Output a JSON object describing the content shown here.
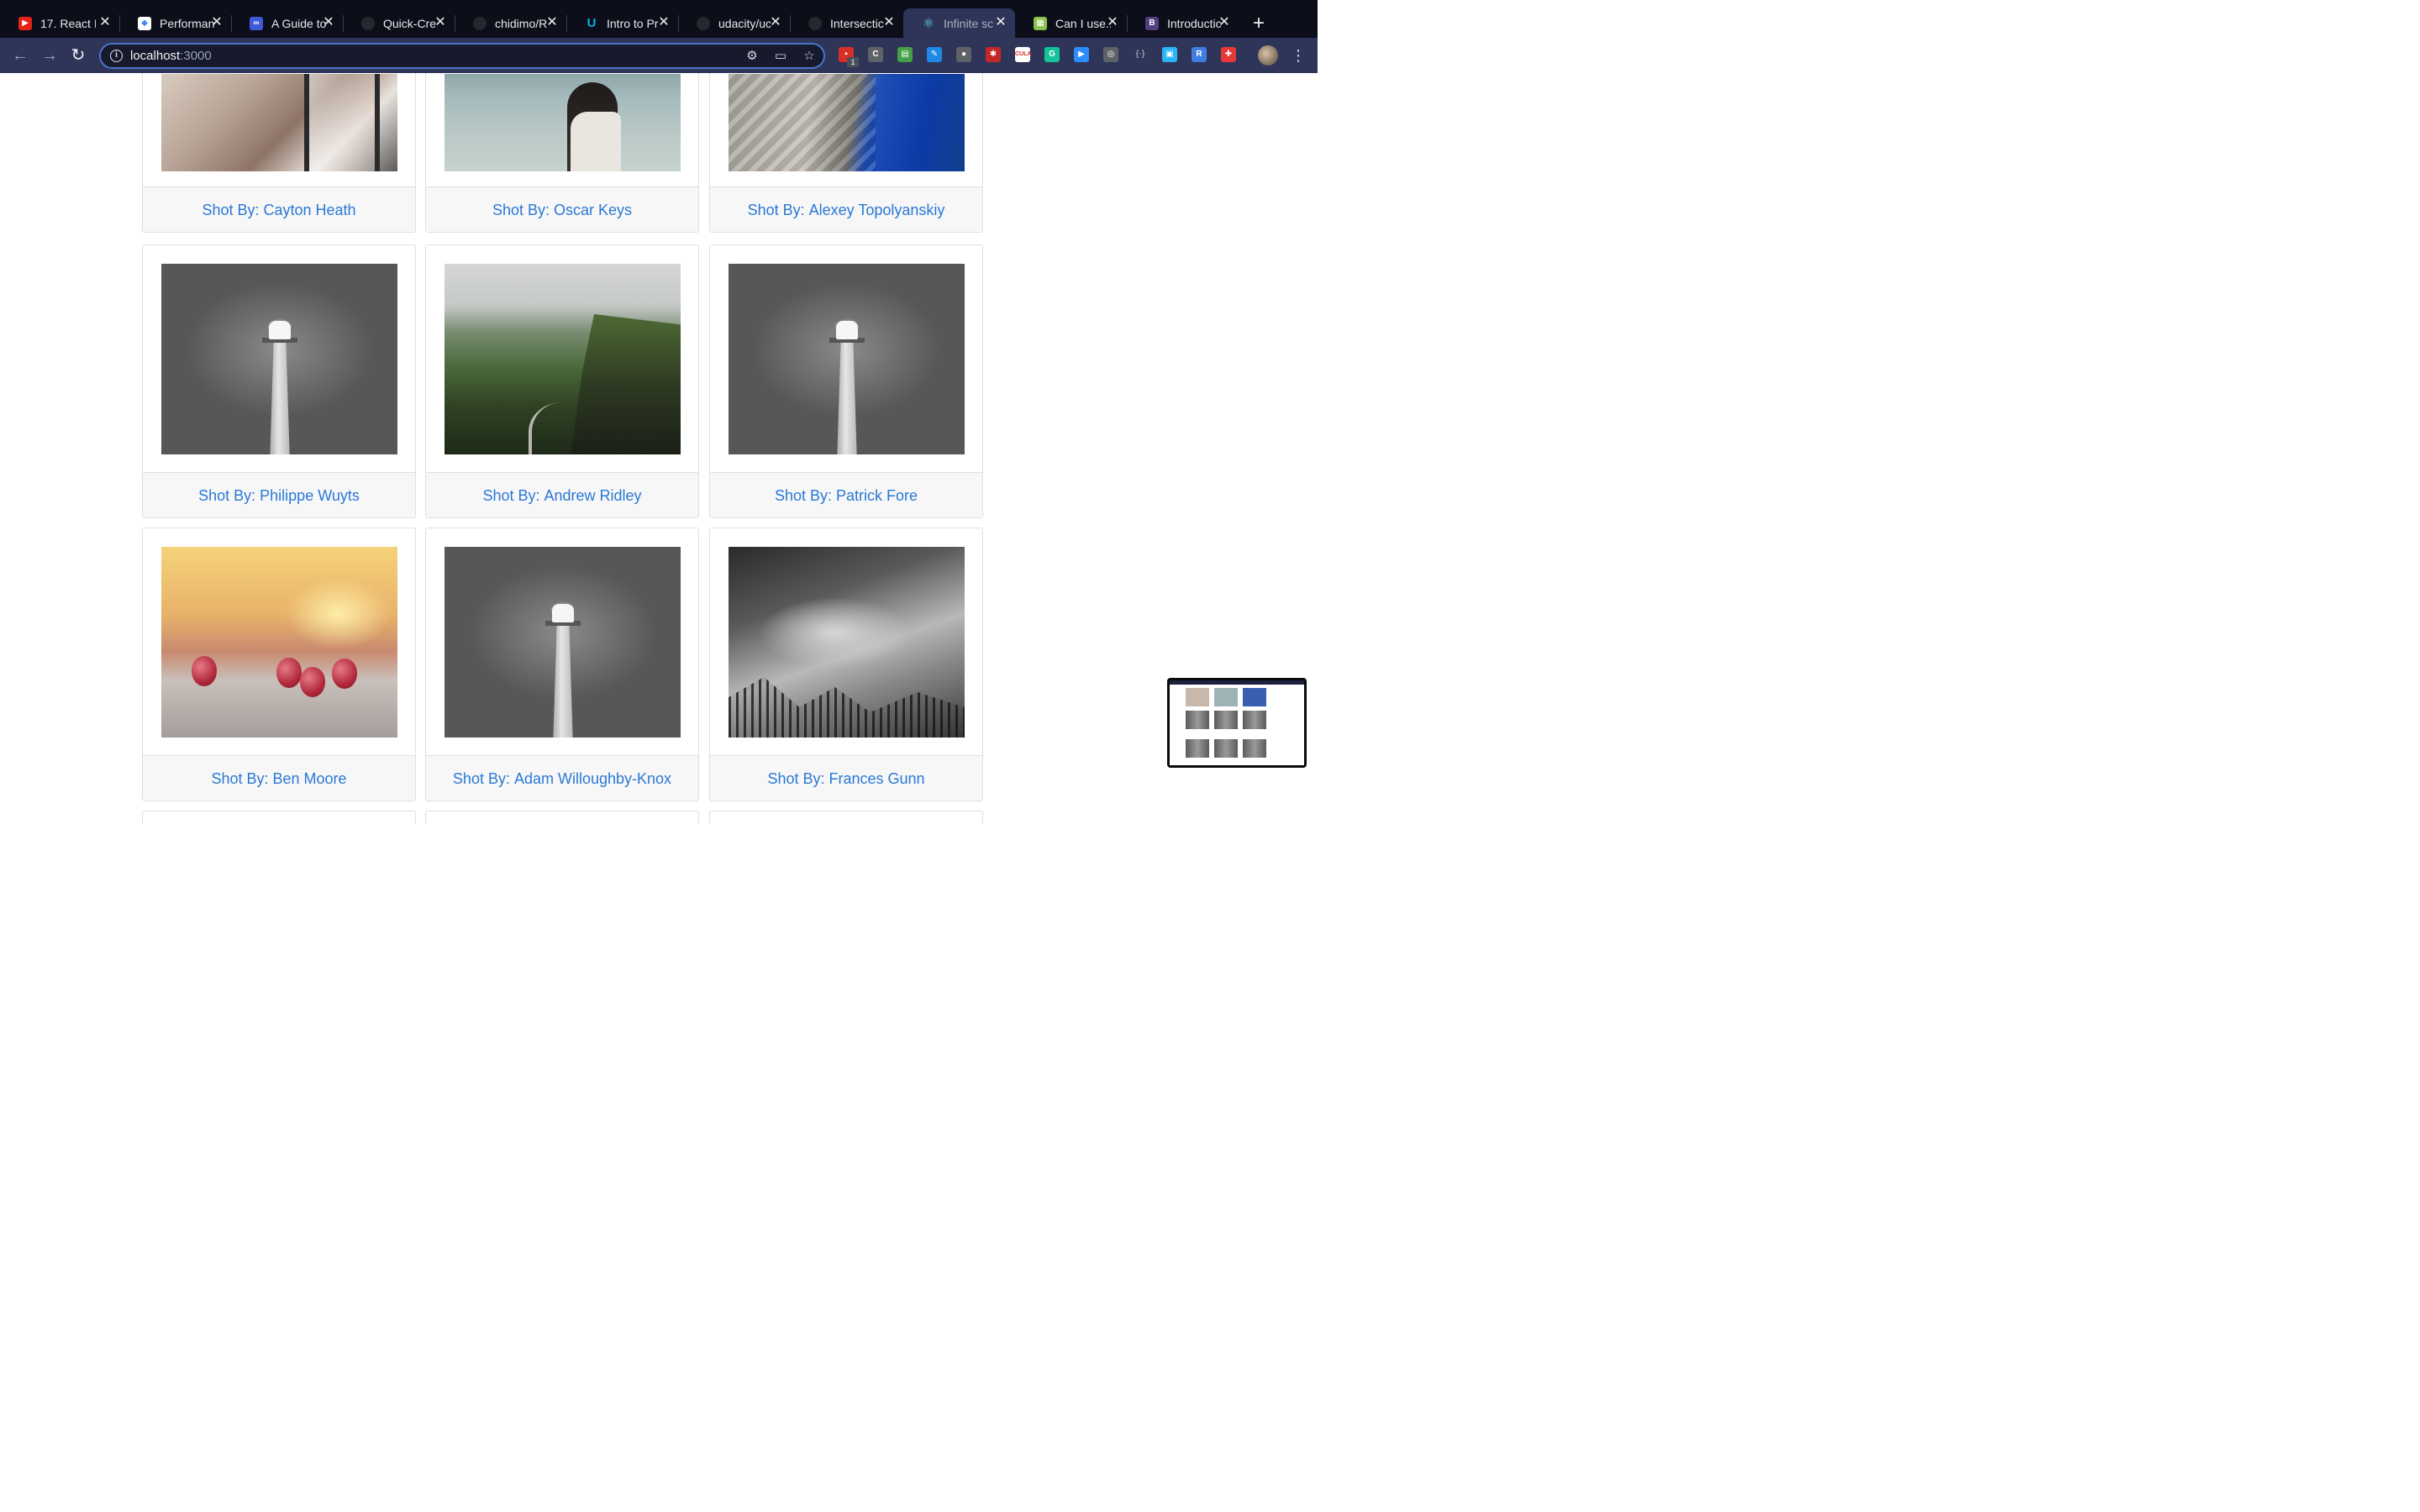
{
  "browser": {
    "tabs": [
      {
        "title": "17. React I",
        "favicon_color": "#e62117",
        "favicon_glyph": "▶"
      },
      {
        "title": "Performan",
        "favicon_color": "#4285f4",
        "favicon_glyph": "◆"
      },
      {
        "title": "A Guide to",
        "favicon_color": "#3d5bd9",
        "favicon_glyph": "∞"
      },
      {
        "title": "Quick-Cre",
        "favicon_color": "#24292e",
        "favicon_glyph": "●"
      },
      {
        "title": "chidimo/R",
        "favicon_color": "#24292e",
        "favicon_glyph": "●"
      },
      {
        "title": "Intro to Pr",
        "favicon_color": "#02b3e4",
        "favicon_glyph": "U"
      },
      {
        "title": "udacity/uc",
        "favicon_color": "#24292e",
        "favicon_glyph": "●"
      },
      {
        "title": "Intersectic",
        "favicon_color": "#24292e",
        "favicon_glyph": "●"
      },
      {
        "title": "Infinite sc",
        "favicon_color": "#61dafb",
        "favicon_glyph": "⚛",
        "active": true
      },
      {
        "title": "Can I use..",
        "favicon_color": "#8bc34a",
        "favicon_glyph": "▦"
      },
      {
        "title": "Introductic",
        "favicon_color": "#563d7c",
        "favicon_glyph": "B"
      }
    ],
    "address": {
      "host": "localhost",
      "port": ":3000"
    },
    "extension_badge": "1",
    "extensions": [
      {
        "name": "todo-ext-icon",
        "color": "#d93025",
        "glyph": "▪"
      },
      {
        "name": "cs-ext-icon",
        "color": "#5f6368",
        "glyph": "C"
      },
      {
        "name": "printer-ext-icon",
        "color": "#43a047",
        "glyph": "▤"
      },
      {
        "name": "feather-ext-icon",
        "color": "#1e88e5",
        "glyph": "✎"
      },
      {
        "name": "circle-ext-icon",
        "color": "#5f6368",
        "glyph": "●"
      },
      {
        "name": "bug-ext-icon",
        "color": "#c62828",
        "glyph": "✱"
      },
      {
        "name": "cula-ext-icon",
        "color": "#ffffff",
        "glyph": "CULA"
      },
      {
        "name": "grammarly-ext-icon",
        "color": "#15c39a",
        "glyph": "G"
      },
      {
        "name": "zoom-ext-icon",
        "color": "#2d8cff",
        "glyph": "▶"
      },
      {
        "name": "target-ext-icon",
        "color": "#5f6368",
        "glyph": "◎"
      },
      {
        "name": "brackets-ext-icon",
        "color": "#2e3558",
        "glyph": "{·}"
      },
      {
        "name": "screen-ext-icon",
        "color": "#29b6f6",
        "glyph": "▣"
      },
      {
        "name": "r-ext-icon",
        "color": "#3f7de0",
        "glyph": "R"
      },
      {
        "name": "gift-ext-icon",
        "color": "#e53935",
        "glyph": "✚"
      }
    ]
  },
  "gallery": {
    "caption_prefix": "Shot By:",
    "cards": [
      {
        "photographer": "Cayton Heath",
        "photo": "bride"
      },
      {
        "photographer": "Oscar Keys",
        "photo": "scarf"
      },
      {
        "photographer": "Alexey Topolyanskiy",
        "photo": "fjord"
      },
      {
        "photographer": "Philippe Wuyts",
        "photo": "lighthouse"
      },
      {
        "photographer": "Andrew Ridley",
        "photo": "mountain"
      },
      {
        "photographer": "Patrick Fore",
        "photo": "lighthouse"
      },
      {
        "photographer": "Ben Moore",
        "photo": "raspberries"
      },
      {
        "photographer": "Adam Willoughby-Knox",
        "photo": "lighthouse"
      },
      {
        "photographer": "Frances Gunn",
        "photo": "foggy-forest"
      }
    ]
  },
  "colors": {
    "caption_link": "#2a78d6",
    "tabstrip_bg": "#0c0e1a",
    "toolbar_bg": "#2e3558"
  }
}
